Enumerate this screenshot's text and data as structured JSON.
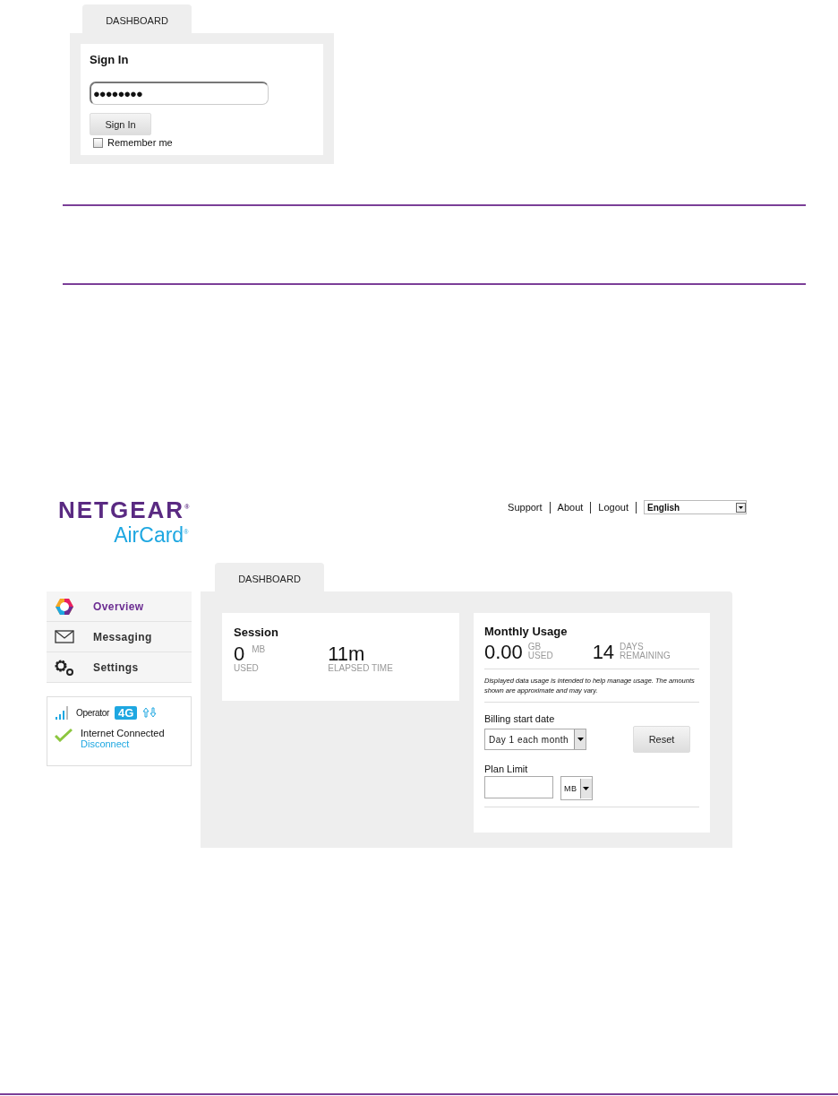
{
  "signin_screen": {
    "tab": {
      "label": "DASHBOARD",
      "selected": true
    },
    "title": "Sign In",
    "password": {
      "value": "●●●●●●●●"
    },
    "button": "Sign In",
    "remember_me": {
      "label": "Remember me",
      "checked": false
    }
  },
  "dashboard_screen": {
    "logo": {
      "brand": "NETGEAR$^{®}$",
      "product": "AirCard$^{®}$"
    },
    "top_links": [
      "Support",
      "About",
      "Logout"
    ],
    "language": {
      "value": "English"
    },
    "tab": {
      "label": "DASHBOARD",
      "selected": true
    },
    "sidebar": {
      "items": [
        {
          "label": "Overview",
          "selected": true,
          "kind": "overview"
        },
        {
          "label": "Messaging",
          "selected": false,
          "kind": "messaging"
        },
        {
          "label": "Settings",
          "selected": false,
          "kind": "settings"
        }
      ]
    },
    "status": {
      "operator": "Operator",
      "network": "4G",
      "connection": "Internet Connected",
      "action": "Disconnect"
    },
    "session": {
      "title": "Session",
      "used": "0",
      "used_unit": "MB",
      "used_label": "USED",
      "elapsed": "11m",
      "elapsed_label": "ELAPSED TIME"
    },
    "monthly": {
      "title": "Monthly Usage",
      "used": "0.00",
      "used_unit": "GB",
      "used_label": "USED",
      "days": "14",
      "days_unit": "DAYS",
      "days_label": "REMAINING",
      "note": "Displayed data usage is intended to help manage usage. The amounts shown are approximate and may vary.",
      "billing_label": "Billing start date",
      "billing_value": "Day 1 each month",
      "reset_button": "Reset",
      "plan_label": "Plan Limit",
      "plan_unit": "MB"
    }
  }
}
